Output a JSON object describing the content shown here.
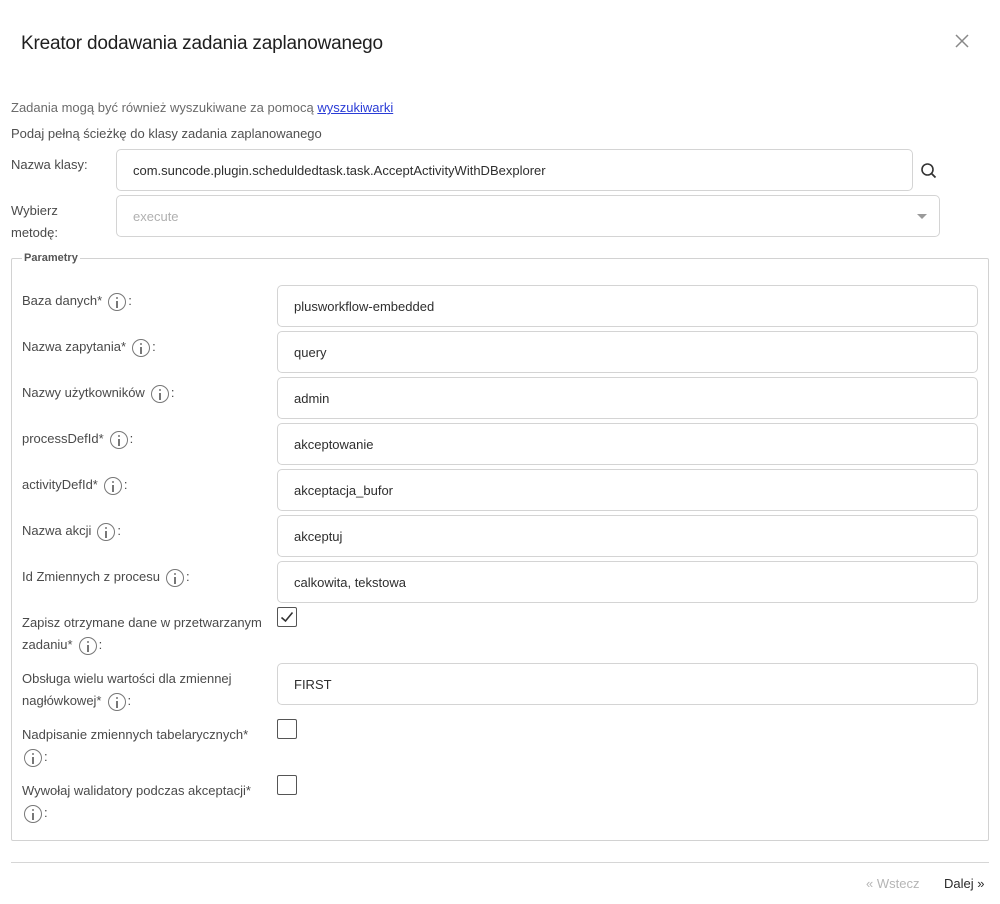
{
  "dialog": {
    "title": "Kreator dodawania zadania zaplanowanego",
    "hint_prefix": "Zadania mogą być również wyszukiwane za pomocą ",
    "hint_link": "wyszukiwarki",
    "hint_path": "Podaj pełną ścieżkę do klasy zadania zaplanowanego"
  },
  "class_field": {
    "label": "Nazwa klasy:",
    "value": "com.suncode.plugin.scheduldedtask.task.AcceptActivityWithDBexplorer"
  },
  "method_field": {
    "label_line1": "Wybierz",
    "label_line2": "metodę:",
    "value": "execute"
  },
  "params": {
    "legend": "Parametry",
    "baza": {
      "label": "Baza danych*",
      "value": "plusworkflow-embedded"
    },
    "zapytanie": {
      "label": "Nazwa zapytania*",
      "value": "query"
    },
    "uzytkownicy": {
      "label": "Nazwy użytkowników",
      "value": "admin"
    },
    "process": {
      "label": "processDefId*",
      "value": "akceptowanie"
    },
    "activity": {
      "label": "activityDefId*",
      "value": "akceptacja_bufor"
    },
    "akcja": {
      "label": "Nazwa akcji",
      "value": "akceptuj"
    },
    "zmienne": {
      "label": "Id Zmiennych z procesu",
      "value": "calkowita, tekstowa"
    },
    "zapisz": {
      "label_line1": "Zapisz otrzymane dane w przetwarzanym",
      "label_line2": "zadaniu*",
      "checked": true
    },
    "obsluga": {
      "label_line1": "Obsługa wielu wartości dla zmiennej",
      "label_line2": "nagłówkowej*",
      "value": "FIRST"
    },
    "nadpisanie": {
      "label": "Nadpisanie zmiennych tabelarycznych*",
      "checked": false
    },
    "walidatory": {
      "label": "Wywołaj walidatory podczas akceptacji*",
      "checked": false
    }
  },
  "footer": {
    "back_label": "« Wstecz",
    "next_label": "Dalej »"
  },
  "icons": {
    "close": "close-icon",
    "search": "search-icon",
    "info": "info-icon",
    "dropdown": "chevron-down-icon",
    "check": "check-icon"
  },
  "colors": {
    "link": "#2a3cd6",
    "border": "#d4d4d4",
    "disabled_text": "#b0b0b0"
  }
}
